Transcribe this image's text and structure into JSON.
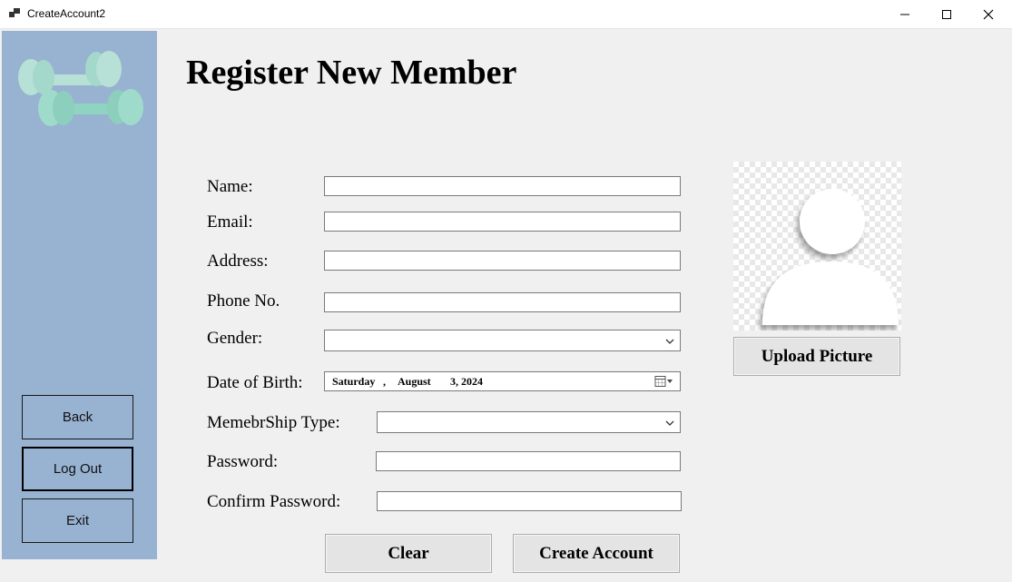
{
  "window": {
    "title": "CreateAccount2",
    "icons": [
      "app-icon",
      "minimize-icon",
      "maximize-icon",
      "close-icon"
    ]
  },
  "sidebar": {
    "logo_icon": "dumbbell-icon",
    "background": "#98b2d1",
    "buttons": [
      {
        "label": "Back"
      },
      {
        "label": "Log Out"
      },
      {
        "label": "Exit"
      }
    ]
  },
  "main": {
    "title": "Register New Member",
    "form": {
      "name": {
        "label": "Name:",
        "value": ""
      },
      "email": {
        "label": "Email:",
        "value": ""
      },
      "address": {
        "label": "Address:",
        "value": ""
      },
      "phone": {
        "label": "Phone No.",
        "value": ""
      },
      "gender": {
        "label": "Gender:",
        "value": ""
      },
      "dob": {
        "label": "Date of Birth:",
        "weekday": "Saturday",
        "sep": ",",
        "month": "August",
        "day_year": "3, 2024"
      },
      "membership": {
        "label": "MemebrShip Type:",
        "value": ""
      },
      "password": {
        "label": "Password:",
        "value": ""
      },
      "confirm_password": {
        "label": "Confirm Password:",
        "value": ""
      }
    },
    "actions": {
      "clear": "Clear",
      "create": "Create Account"
    },
    "photo": {
      "icon": "user-silhouette-icon",
      "upload_label": "Upload Picture"
    }
  }
}
